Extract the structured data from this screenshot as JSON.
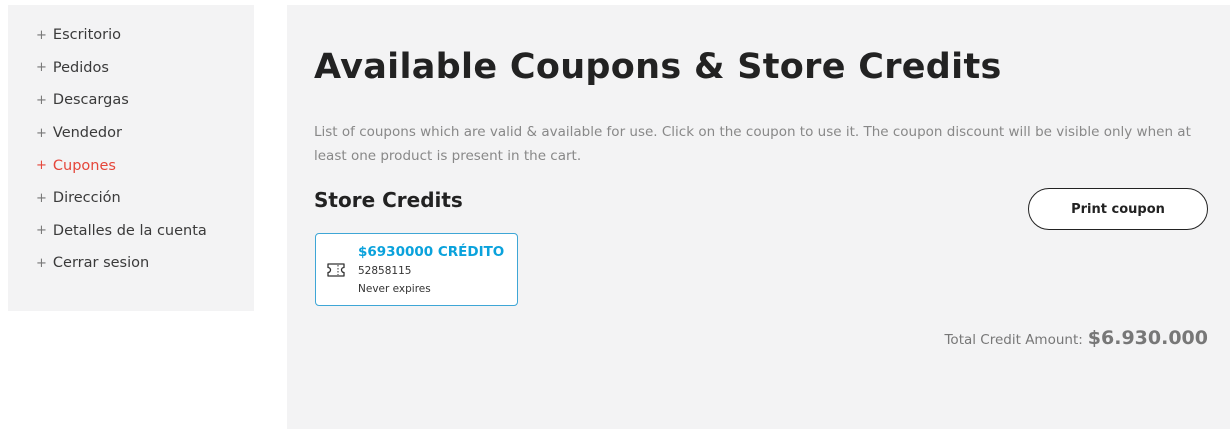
{
  "sidebar": {
    "items": [
      {
        "label": "Escritorio"
      },
      {
        "label": "Pedidos"
      },
      {
        "label": "Descargas"
      },
      {
        "label": "Vendedor"
      },
      {
        "label": "Cupones"
      },
      {
        "label": "Dirección"
      },
      {
        "label": "Detalles de la cuenta"
      },
      {
        "label": "Cerrar sesion"
      }
    ],
    "bullet": "+",
    "active_index": 4
  },
  "main": {
    "title": "Available Coupons & Store Credits",
    "description": "List of coupons which are valid & available for use. Click on the coupon to use it. The coupon discount will be visible only when at least one product is present in the cart.",
    "store_credits_title": "Store Credits",
    "print_button_label": "Print coupon",
    "coupons": [
      {
        "amount": "$6930000 CRÉDITO",
        "code": "52858115",
        "expiry": "Never expires",
        "icon": "ticket-icon"
      }
    ],
    "total_label": "Total Credit Amount:",
    "total_value": "$6.930.000"
  },
  "colors": {
    "active_nav": "#e5463a",
    "coupon_amount": "#0aa2dc",
    "coupon_border": "#3ea6d6",
    "panel_bg": "#f3f3f4"
  }
}
